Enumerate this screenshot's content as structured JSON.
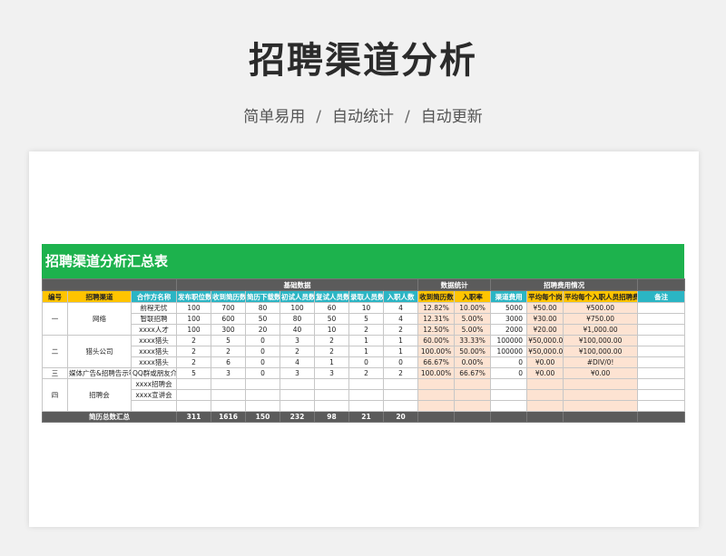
{
  "header": {
    "title": "招聘渠道分析",
    "subtitle_items": [
      "简单易用",
      "自动统计",
      "自动更新"
    ],
    "separator": "/"
  },
  "sheet": {
    "title": "招聘渠道分析汇总表",
    "groups": {
      "basic": "基础数据",
      "stats": "数据统计",
      "cost": "招聘费用情况"
    },
    "columns": [
      "编号",
      "招聘渠道",
      "合作方名称",
      "发布职位数",
      "收到简历数",
      "简历下载数",
      "初试人员数",
      "复试人员数",
      "录取人员数",
      "入职人数",
      "收到简历数",
      "入职率",
      "渠道费用",
      "平均每个岗位招聘",
      "平均每个入职人员招聘费用",
      "备注"
    ],
    "rows": [
      {
        "no": "一",
        "channel": "网络",
        "partner": "前程无忧",
        "posts": "100",
        "resumes": "700",
        "downloads": "80",
        "first": "100",
        "second": "60",
        "hired": "10",
        "joined": "4",
        "ratio": "12.82%",
        "rate": "10.00%",
        "fee": "5000",
        "avg_post": "¥50.00",
        "avg_join": "¥500.00"
      },
      {
        "no": "",
        "channel": "",
        "partner": "智联招聘",
        "posts": "100",
        "resumes": "600",
        "downloads": "50",
        "first": "80",
        "second": "50",
        "hired": "5",
        "joined": "4",
        "ratio": "12.31%",
        "rate": "5.00%",
        "fee": "3000",
        "avg_post": "¥30.00",
        "avg_join": "¥750.00"
      },
      {
        "no": "",
        "channel": "",
        "partner": "xxxx人才",
        "posts": "100",
        "resumes": "300",
        "downloads": "20",
        "first": "40",
        "second": "10",
        "hired": "2",
        "joined": "2",
        "ratio": "12.50%",
        "rate": "5.00%",
        "fee": "2000",
        "avg_post": "¥20.00",
        "avg_join": "¥1,000.00"
      },
      {
        "no": "二",
        "channel": "猎头公司",
        "partner": "xxxx猎头",
        "posts": "2",
        "resumes": "5",
        "downloads": "0",
        "first": "3",
        "second": "2",
        "hired": "1",
        "joined": "1",
        "ratio": "60.00%",
        "rate": "33.33%",
        "fee": "100000",
        "avg_post": "¥50,000.00",
        "avg_join": "¥100,000.00"
      },
      {
        "no": "",
        "channel": "",
        "partner": "xxxx猎头",
        "posts": "2",
        "resumes": "2",
        "downloads": "0",
        "first": "2",
        "second": "2",
        "hired": "1",
        "joined": "1",
        "ratio": "100.00%",
        "rate": "50.00%",
        "fee": "100000",
        "avg_post": "¥50,000.00",
        "avg_join": "¥100,000.00"
      },
      {
        "no": "",
        "channel": "",
        "partner": "xxxx猎头",
        "posts": "2",
        "resumes": "6",
        "downloads": "0",
        "first": "4",
        "second": "1",
        "hired": "0",
        "joined": "0",
        "ratio": "66.67%",
        "rate": "0.00%",
        "fee": "0",
        "avg_post": "¥0.00",
        "avg_join": "#DIV/0!"
      },
      {
        "no": "三",
        "channel": "媒体广告&招聘告示等",
        "partner": "QQ群或朋友介绍",
        "posts": "5",
        "resumes": "3",
        "downloads": "0",
        "first": "3",
        "second": "3",
        "hired": "2",
        "joined": "2",
        "ratio": "100.00%",
        "rate": "66.67%",
        "fee": "0",
        "avg_post": "¥0.00",
        "avg_join": "¥0.00"
      },
      {
        "no": "四",
        "channel": "招聘会",
        "partner": "xxxx招聘会",
        "posts": "",
        "resumes": "",
        "downloads": "",
        "first": "",
        "second": "",
        "hired": "",
        "joined": "",
        "ratio": "",
        "rate": "",
        "fee": "",
        "avg_post": "",
        "avg_join": ""
      },
      {
        "no": "",
        "channel": "",
        "partner": "xxxx宣讲会",
        "posts": "",
        "resumes": "",
        "downloads": "",
        "first": "",
        "second": "",
        "hired": "",
        "joined": "",
        "ratio": "",
        "rate": "",
        "fee": "",
        "avg_post": "",
        "avg_join": ""
      }
    ],
    "total": {
      "label": "简历总数汇总",
      "posts": "311",
      "resumes": "1616",
      "downloads": "150",
      "first": "232",
      "second": "98",
      "hired": "21",
      "joined": "20"
    }
  }
}
